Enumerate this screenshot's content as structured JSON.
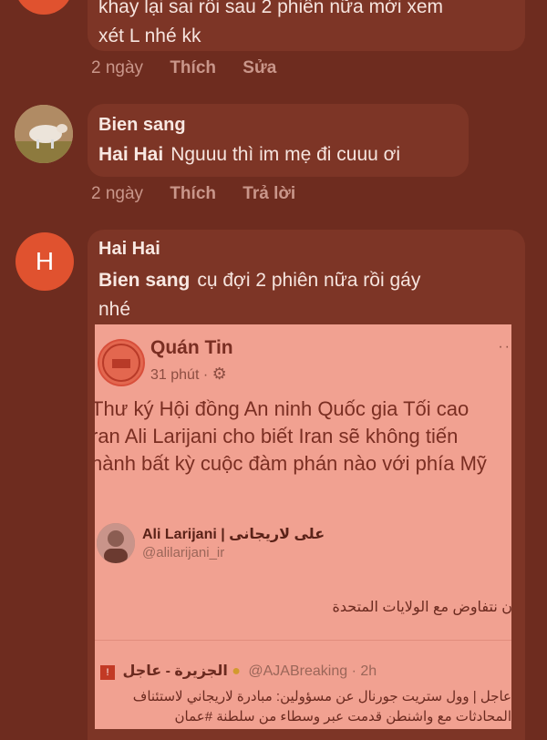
{
  "comments": [
    {
      "text_line1": "khay lại sai rồi sau 2 phiên nữa mới xem",
      "text_line2": "xét L nhé kk",
      "time": "2 ngày",
      "like": "Thích",
      "action": "Sửa"
    },
    {
      "author": "Bien sang",
      "mention": "Hai Hai",
      "text": "Nguuu thì im mẹ đi cuuu ơi",
      "time": "2 ngày",
      "like": "Thích",
      "action": "Trả lời",
      "avatar_icon": "sheep-photo"
    },
    {
      "author": "Hai Hai",
      "avatar_letter": "H",
      "mention": "Bien sang",
      "text_line1": "cụ đợi 2 phiên nữa rồi gáy",
      "text_line2": "nhé"
    }
  ],
  "shared_post": {
    "page_name": "Quán Tin",
    "time": "31 phút",
    "more": "··",
    "text_line1": "Thư ký Hội đồng An ninh Quốc gia Tối cao",
    "text_line2": "ran Ali Larijani cho biết Iran sẽ không tiến",
    "text_line3": "hành bất kỳ cuộc đàm phán nào với phía Mỹ",
    "tweet": {
      "name": "Ali Larijani | علی لاریجانی",
      "handle": "@alilarijani_ir",
      "body": "ن نتفاوض مع الولايات المتحدة"
    },
    "quoted": {
      "source": "الجزيرة - عاجل",
      "handle": "@AJABreaking · 2h",
      "body_line1": "عاجل | وول ستريت جورنال عن مسؤولين: مبادرة لاريجاني لاستئناف",
      "body_line2": "المحادثات مع واشنطن قدمت عبر وسطاء من سلطنة #عمان"
    }
  },
  "colors": {
    "background": "#6e2c1f",
    "bubble": "#7d3526",
    "avatar_h": "#e0522f",
    "card": "#f1a191"
  }
}
